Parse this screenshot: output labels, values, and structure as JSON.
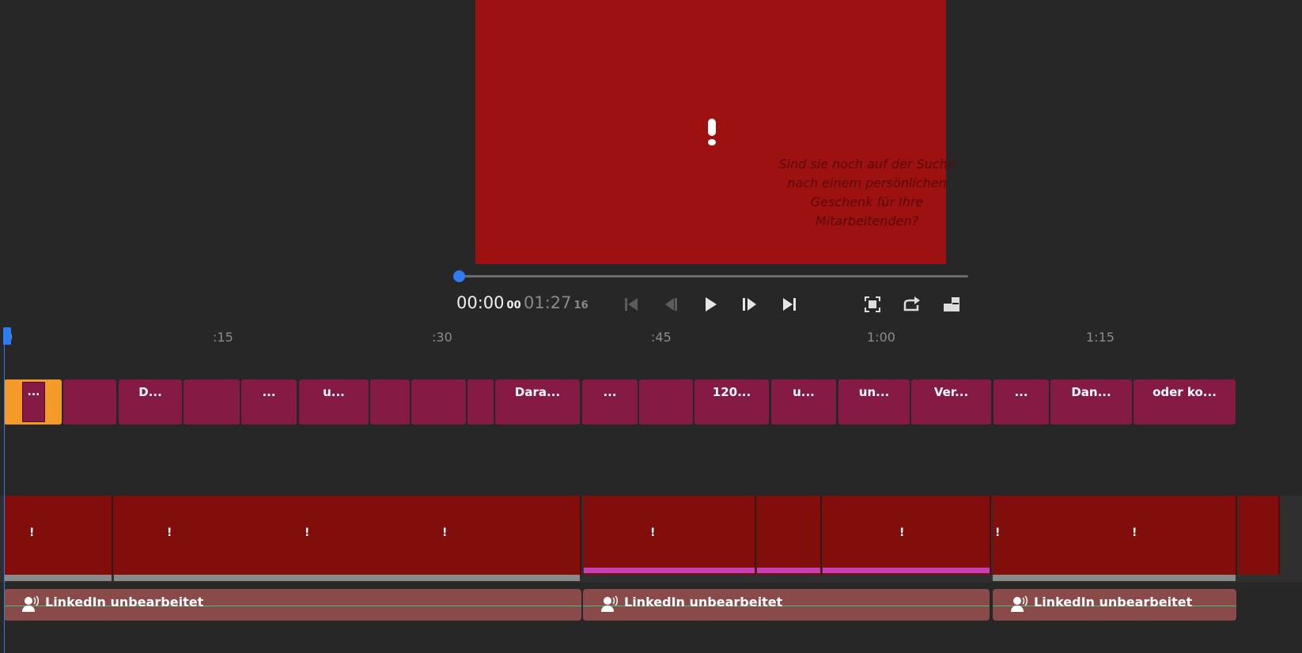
{
  "preview": {
    "caption_text": "Sind sie noch auf der Suche nach einem persönlichen Geschenk für Ihre Mitarbeitenden?"
  },
  "transport": {
    "current_time": "00:00",
    "current_frames": "00",
    "duration": "01:27",
    "duration_frames": "16",
    "playback_progress": 0
  },
  "ruler": {
    "labels": [
      "0",
      ":15",
      ":30",
      ":45",
      "1:00",
      "1:15"
    ]
  },
  "caption_track": {
    "clips": [
      "...",
      "",
      "D...",
      "",
      "...",
      "u...",
      "",
      "",
      "",
      "Dara...",
      "...",
      "",
      "120...",
      "u...",
      "un...",
      "Ver...",
      "...",
      "Dan...",
      "oder ko..."
    ]
  },
  "video_track": {
    "warning_glyph": "!"
  },
  "audio_track": {
    "clips": [
      {
        "label": "LinkedIn unbearbeitet"
      },
      {
        "label": "LinkedIn unbearbeitet"
      },
      {
        "label": "LinkedIn unbearbeitet"
      }
    ]
  },
  "colors": {
    "accent": "#2f7bf2",
    "caption_clip": "#851a45",
    "selected_clip": "#f39a29",
    "video_clip": "#820e0b",
    "audio_clip": "#8a4a4a",
    "preview_bg": "#9e1111"
  }
}
